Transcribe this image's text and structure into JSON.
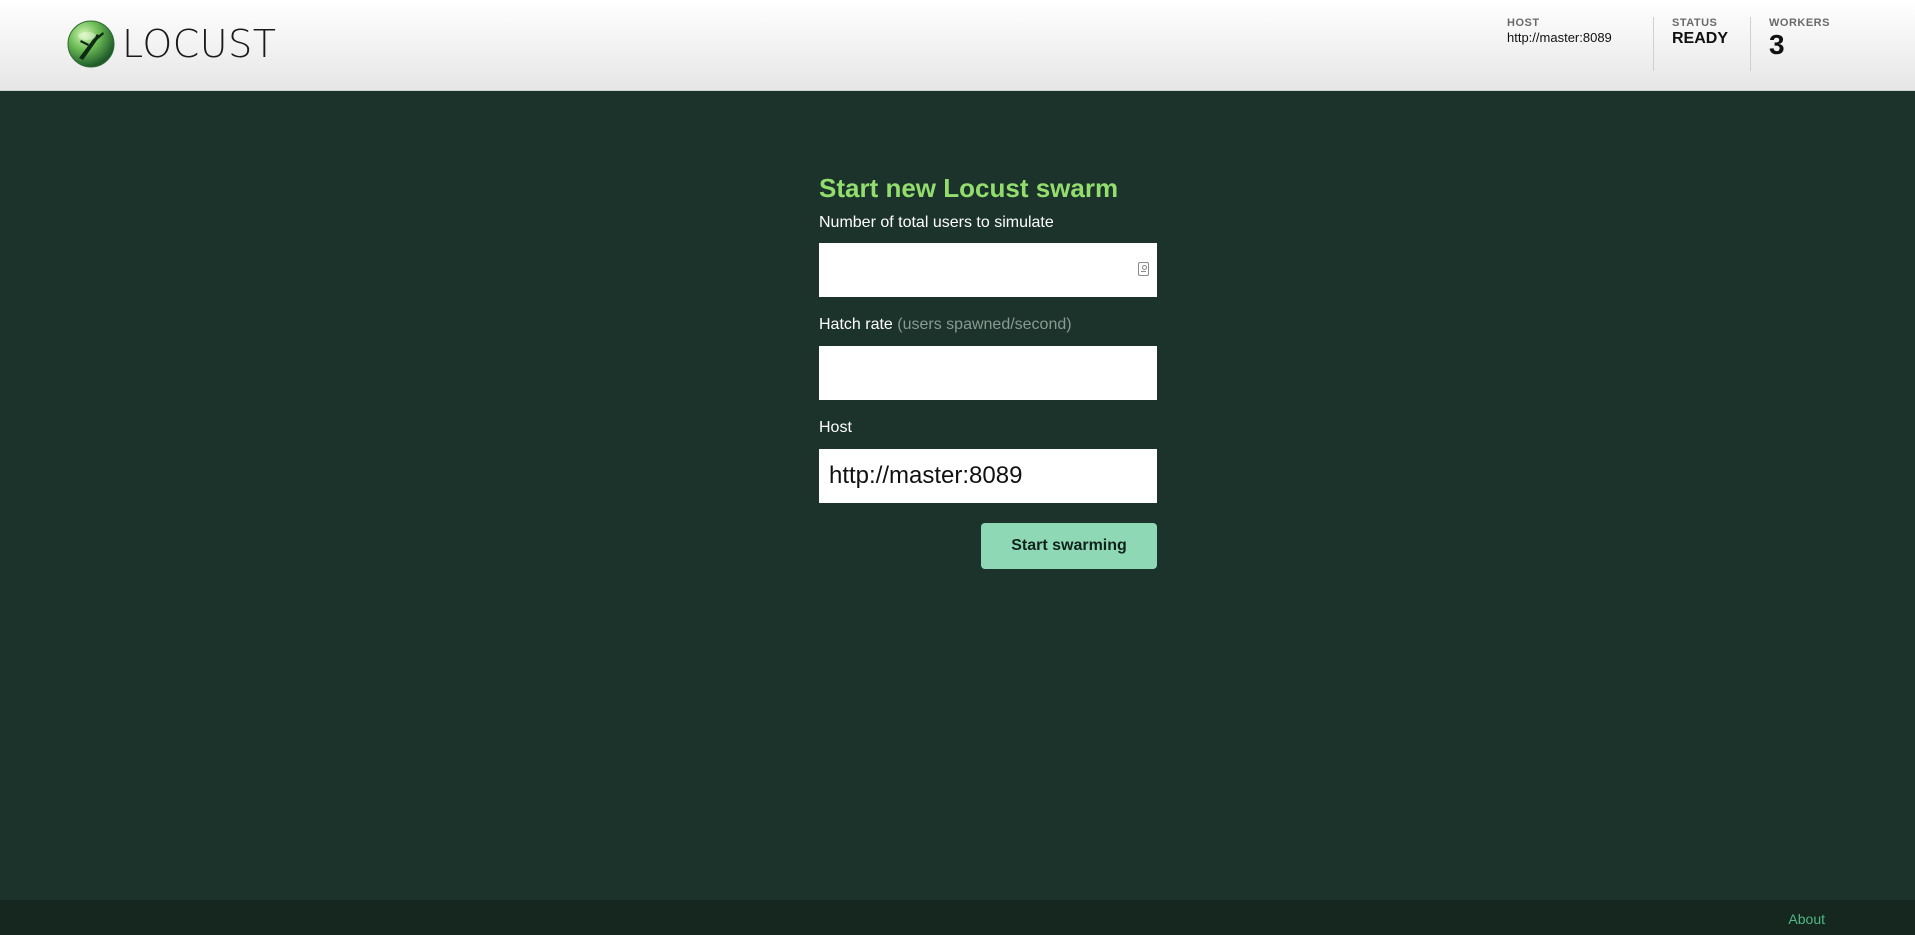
{
  "header": {
    "logo_text": "LOCUST",
    "stats": {
      "host_label": "HOST",
      "host_value": "http://master:8089",
      "status_label": "STATUS",
      "status_value": "READY",
      "workers_label": "WORKERS",
      "workers_value": "3"
    }
  },
  "form": {
    "title": "Start new Locust swarm",
    "users_label": "Number of total users to simulate",
    "users_value": "",
    "hatch_label": "Hatch rate",
    "hatch_hint": "(users spawned/second)",
    "hatch_value": "",
    "host_label": "Host",
    "host_value": "http://master:8089",
    "submit_label": "Start swarming"
  },
  "footer": {
    "about_label": "About"
  },
  "colors": {
    "background": "#1b332a",
    "title_green": "#92dd6e",
    "button_green": "#8fd8b6",
    "footer_bg": "#15271f",
    "about_link": "#4fb885"
  }
}
